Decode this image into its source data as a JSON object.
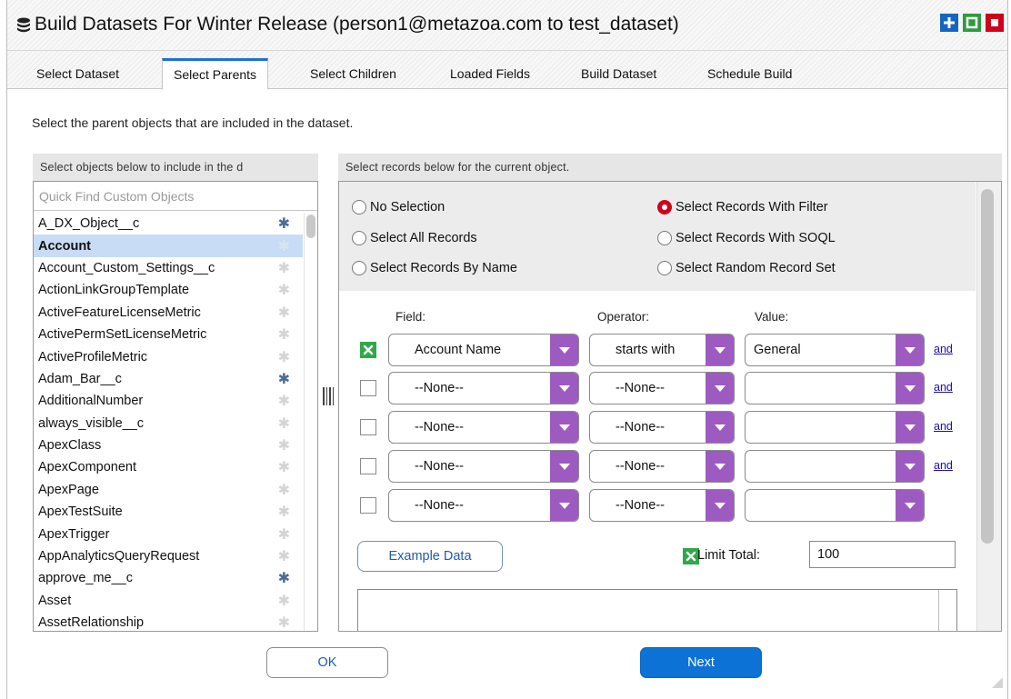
{
  "window": {
    "title": "Build Datasets For Winter Release (person1@metazoa.com to test_dataset)"
  },
  "tabs": [
    {
      "label": "Select Dataset"
    },
    {
      "label": "Select Parents",
      "active": true
    },
    {
      "label": "Select Children"
    },
    {
      "label": "Loaded Fields"
    },
    {
      "label": "Build Dataset"
    },
    {
      "label": "Schedule Build"
    }
  ],
  "instructions": "Select the parent objects that are included in the dataset.",
  "left_panel": {
    "header": "Select objects below to include in the d",
    "search_placeholder": "Quick Find Custom Objects",
    "items": [
      {
        "label": "A_DX_Object__c",
        "starred": true
      },
      {
        "label": "Account",
        "starred": false,
        "selected": true
      },
      {
        "label": "Account_Custom_Settings__c",
        "starred": false
      },
      {
        "label": "ActionLinkGroupTemplate",
        "starred": false
      },
      {
        "label": "ActiveFeatureLicenseMetric",
        "starred": false
      },
      {
        "label": "ActivePermSetLicenseMetric",
        "starred": false
      },
      {
        "label": "ActiveProfileMetric",
        "starred": false
      },
      {
        "label": "Adam_Bar__c",
        "starred": true
      },
      {
        "label": "AdditionalNumber",
        "starred": false
      },
      {
        "label": "always_visible__c",
        "starred": false
      },
      {
        "label": "ApexClass",
        "starred": false
      },
      {
        "label": "ApexComponent",
        "starred": false
      },
      {
        "label": "ApexPage",
        "starred": false
      },
      {
        "label": "ApexTestSuite",
        "starred": false
      },
      {
        "label": "ApexTrigger",
        "starred": false
      },
      {
        "label": "AppAnalyticsQueryRequest",
        "starred": false
      },
      {
        "label": "approve_me__c",
        "starred": true
      },
      {
        "label": "Asset",
        "starred": false
      },
      {
        "label": "AssetRelationship",
        "starred": false
      }
    ]
  },
  "right_panel": {
    "header": "Select records below for the current object.",
    "radios": [
      {
        "label": "No Selection",
        "checked": false
      },
      {
        "label": "Select Records With Filter",
        "checked": true
      },
      {
        "label": "Select All Records",
        "checked": false
      },
      {
        "label": "Select Records With SOQL",
        "checked": false
      },
      {
        "label": "Select Records By Name",
        "checked": false
      },
      {
        "label": "Select Random Record Set",
        "checked": false
      }
    ],
    "columns": {
      "field": "Field:",
      "operator": "Operator:",
      "value": "Value:"
    },
    "filters": [
      {
        "checked": true,
        "field": "Account Name",
        "operator": "starts with",
        "value": "General",
        "connector": "and"
      },
      {
        "checked": false,
        "field": "--None--",
        "operator": "--None--",
        "value": "",
        "connector": "and"
      },
      {
        "checked": false,
        "field": "--None--",
        "operator": "--None--",
        "value": "",
        "connector": "and"
      },
      {
        "checked": false,
        "field": "--None--",
        "operator": "--None--",
        "value": "",
        "connector": "and"
      },
      {
        "checked": false,
        "field": "--None--",
        "operator": "--None--",
        "value": "",
        "connector": ""
      }
    ],
    "example_button": "Example Data",
    "limit": {
      "checked": true,
      "label": "Limit Total:",
      "value": "100"
    }
  },
  "footer": {
    "ok": "OK",
    "next": "Next"
  },
  "colors": {
    "accent_purple": "#9d5bc2",
    "check_green": "#2fa84a",
    "radio_red": "#d0021b",
    "primary_blue": "#0c72d6"
  }
}
